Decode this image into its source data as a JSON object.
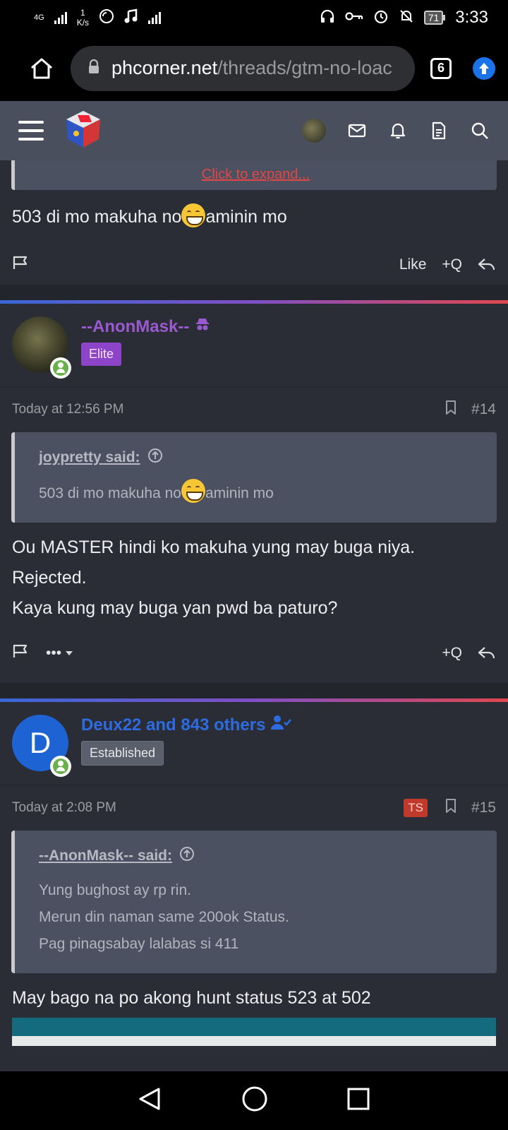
{
  "status_bar": {
    "network": "4G",
    "speed_value": "1",
    "speed_unit": "K/s",
    "battery": "71",
    "time": "3:33"
  },
  "browser": {
    "url_host": "phcorner.net",
    "url_path": "/threads/gtm-no-loac",
    "tab_count": "6"
  },
  "prev_post": {
    "expand_label": "Click to expand...",
    "text_before_emoji": "503 di mo makuha no",
    "text_after_emoji": "aminin mo",
    "like_label": "Like",
    "quote_label": "+Q"
  },
  "posts": [
    {
      "username": "--AnonMask--",
      "username_color": "#9b59d0",
      "badge": "Elite",
      "badge_bg": "#8e44c8",
      "time": "Today at 12:56 PM",
      "number": "#14",
      "quote_author": "joypretty said:",
      "quote_before_emoji": "503 di mo makuha no",
      "quote_after_emoji": "aminin mo",
      "lines": [
        "Ou MASTER hindi ko makuha yung may buga niya.",
        "Rejected.",
        "Kaya kung may buga yan pwd ba paturo?"
      ],
      "more_label": "•••",
      "quote_label": "+Q"
    },
    {
      "username": "Deux22 and 843 others",
      "username_color": "#2d6ce0",
      "avatar_letter": "D",
      "badge": "Established",
      "badge_bg": "#5b5f6b",
      "time": "Today at 2:08 PM",
      "ts_badge": "TS",
      "number": "#15",
      "quote_author": "--AnonMask-- said:",
      "quote_lines": [
        "Yung bughost ay rp rin.",
        "Merun din naman same 200ok Status.",
        "Pag pinagsabay lalabas si 411"
      ],
      "lines": [
        "May bago na po akong hunt status 523 at 502"
      ]
    }
  ]
}
